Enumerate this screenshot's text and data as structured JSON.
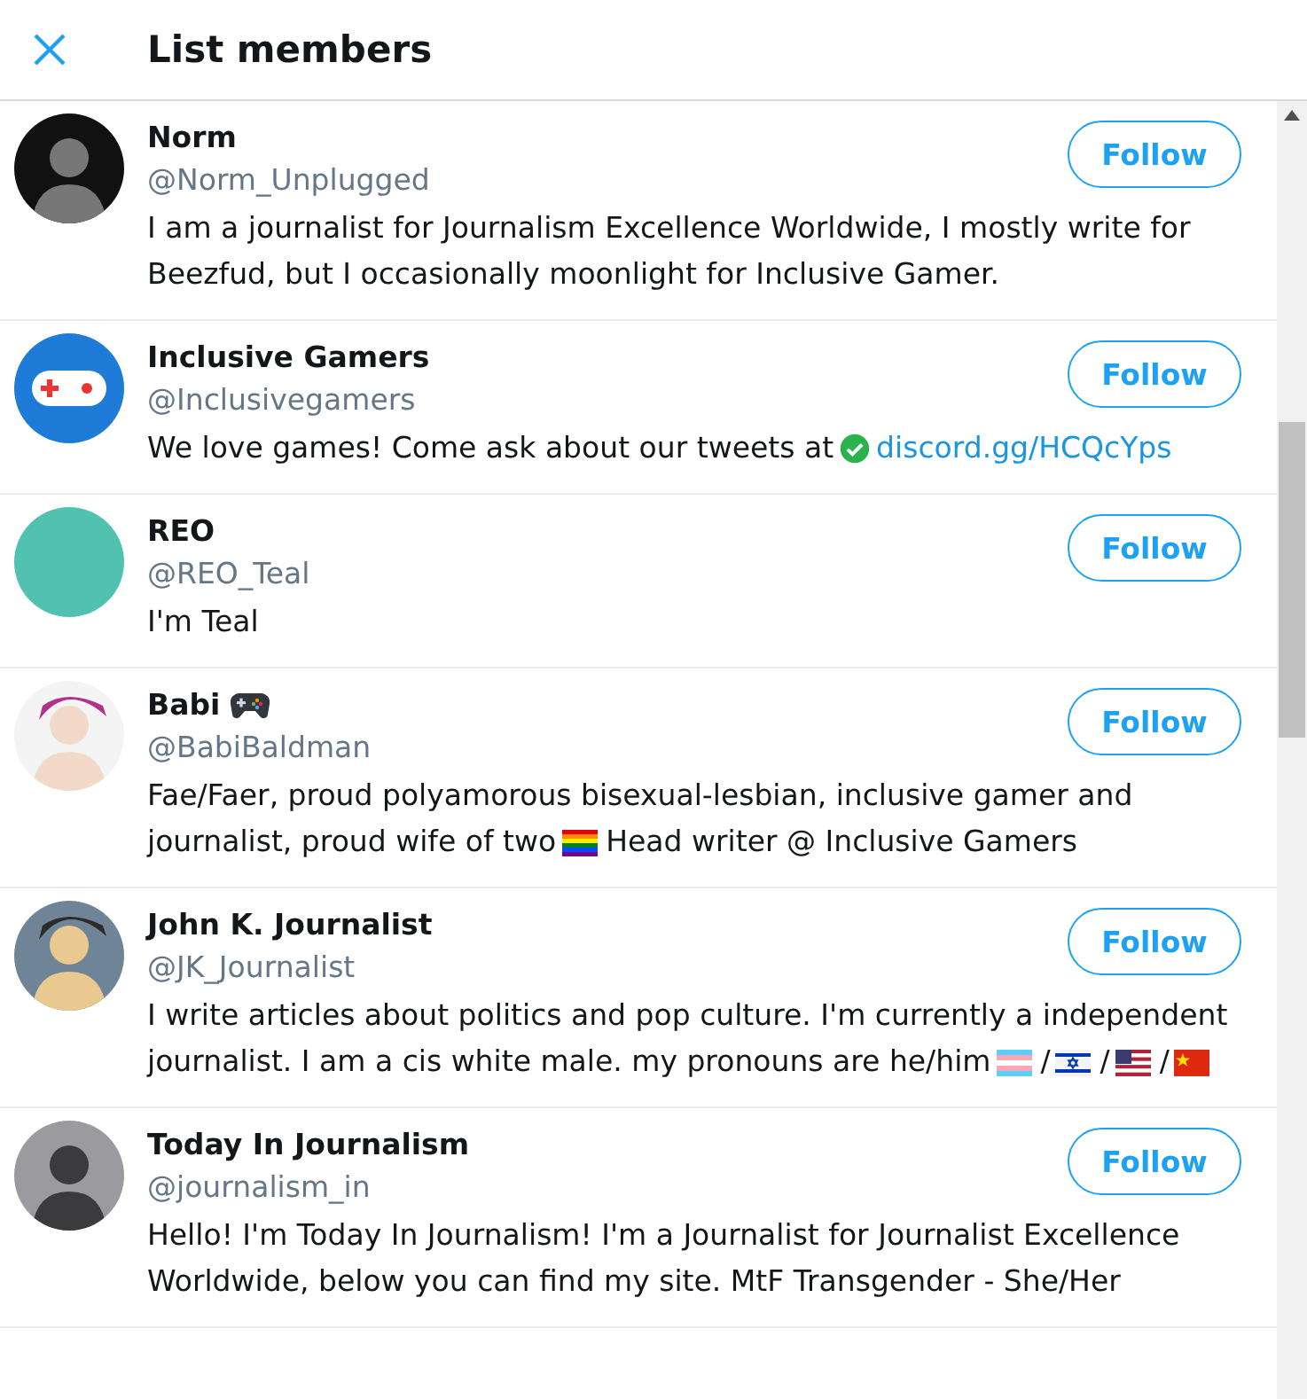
{
  "header": {
    "title": "List members"
  },
  "members": [
    {
      "name": "Norm",
      "handle": "@Norm_Unplugged",
      "avatar": {
        "kind": "photo-dark"
      },
      "button": "Follow",
      "bio_lines": [
        [
          {
            "kind": "text",
            "text": "I am a journalist for Journalism Excellence Worldwide, I mostly write for"
          }
        ],
        [
          {
            "kind": "text",
            "text": "Beezfud, but I occasionally moonlight for Inclusive Gamer."
          }
        ]
      ]
    },
    {
      "name": "Inclusive Gamers",
      "handle": "@Inclusivegamers",
      "avatar": {
        "kind": "gamepad-logo"
      },
      "button": "Follow",
      "bio_lines": [
        [
          {
            "kind": "text",
            "text": "We love games! Come ask about our tweets at"
          },
          {
            "kind": "check"
          },
          {
            "kind": "link",
            "text": "discord.gg/HCQcYps"
          }
        ]
      ]
    },
    {
      "name": "REO",
      "handle": "@REO_Teal",
      "avatar": {
        "kind": "teal"
      },
      "button": "Follow",
      "bio_lines": [
        [
          {
            "kind": "text",
            "text": "I'm Teal"
          }
        ]
      ]
    },
    {
      "name": "Babi",
      "name_icon": {
        "kind": "gamepad"
      },
      "handle": "@BabiBaldman",
      "avatar": {
        "kind": "cartoon-pink"
      },
      "button": "Follow",
      "bio_lines": [
        [
          {
            "kind": "text",
            "text": "Fae/Faer, proud polyamorous bisexual-lesbian, inclusive gamer and"
          }
        ],
        [
          {
            "kind": "text",
            "text": "journalist, proud wife of two"
          },
          {
            "kind": "rainbow-flag"
          },
          {
            "kind": "text",
            "text": "Head writer @ Inclusive Gamers"
          }
        ]
      ]
    },
    {
      "name": "John K. Journalist",
      "handle": "@JK_Journalist",
      "avatar": {
        "kind": "cartoon-grey"
      },
      "button": "Follow",
      "bio_lines": [
        [
          {
            "kind": "text",
            "text": "I write articles about politics and pop culture. I'm currently a independent"
          }
        ],
        [
          {
            "kind": "text",
            "text": "journalist. I am a cis white male. my pronouns are he/him"
          },
          {
            "kind": "trans-flag"
          },
          {
            "kind": "text",
            "text": "/"
          },
          {
            "kind": "star-flag"
          },
          {
            "kind": "text",
            "text": "/"
          },
          {
            "kind": "stripes-flag"
          },
          {
            "kind": "text",
            "text": "/"
          },
          {
            "kind": "red-flag"
          }
        ]
      ]
    },
    {
      "name": "Today In Journalism",
      "handle": "@journalism_in",
      "avatar": {
        "kind": "photo-grey"
      },
      "button": "Follow",
      "bio_lines": [
        [
          {
            "kind": "text",
            "text": "Hello! I'm Today In Journalism! I'm a Journalist for Journalist Excellence"
          }
        ],
        [
          {
            "kind": "text",
            "text": "Worldwide, below you can find my site. MtF Transgender - She/Her"
          }
        ]
      ]
    }
  ]
}
